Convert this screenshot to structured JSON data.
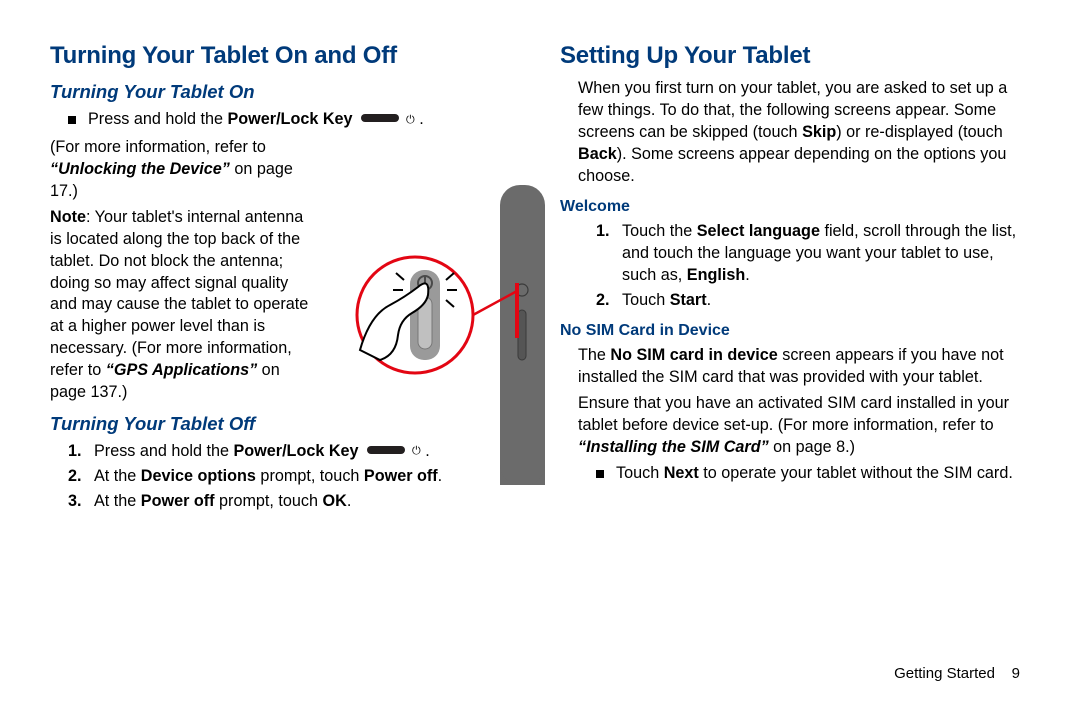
{
  "left": {
    "h1": "Turning Your Tablet On and Off",
    "on_h2": "Turning Your Tablet On",
    "on_bullet_pre": "Press and hold the ",
    "on_bullet_bold": "Power/Lock Key",
    "on_bullet_post": " .",
    "para1_pre": "(For more information, refer to ",
    "para1_ital": "“Unlocking the Device”",
    "para1_mid": " on page 17.)",
    "note_label": "Note",
    "note_body_pre": ": Your tablet's internal antenna is located along the top back of the tablet. Do not block the antenna; doing so may affect signal quality and may cause the tablet to operate at a higher power level than is necessary. (For more information, refer to ",
    "note_ital": "“GPS Applications”",
    "note_post": " on page 137.)",
    "off_h2": "Turning Your Tablet Off",
    "off1_pre": "Press and hold the ",
    "off1_bold": "Power/Lock Key",
    "off1_post": " .",
    "off2_pre": "At the ",
    "off2_bold1": "Device options",
    "off2_mid": " prompt, touch ",
    "off2_bold2": "Power off",
    "off2_post": ".",
    "off3_pre": "At the ",
    "off3_bold1": "Power off",
    "off3_mid": " prompt, touch ",
    "off3_bold2": "OK",
    "off3_post": "."
  },
  "right": {
    "h1": "Setting Up Your Tablet",
    "intro_pre": "When you first turn on your tablet, you are asked to set up a few things. To do that, the following screens appear. Some screens can be skipped (touch ",
    "intro_b1": "Skip",
    "intro_mid": ") or re-displayed (touch ",
    "intro_b2": "Back",
    "intro_post": "). Some screens appear depending on the options you choose.",
    "welcome_h3": "Welcome",
    "w1_pre": "Touch the ",
    "w1_bold": "Select language",
    "w1_mid": " field, scroll through the list, and touch the language you want your tablet to use, such as, ",
    "w1_bold2": "English",
    "w1_post": ".",
    "w2_pre": "Touch ",
    "w2_bold": "Start",
    "w2_post": ".",
    "nosim_h3": "No SIM Card in Device",
    "ns_p1_pre": "The ",
    "ns_p1_bold": "No SIM card in device",
    "ns_p1_post": " screen appears if you have not installed the SIM card that was provided with your tablet.",
    "ns_p2_pre": "Ensure that you have an activated SIM card installed in your tablet before device set-up. (For more information, refer to ",
    "ns_p2_ital": "“Installing the SIM Card”",
    "ns_p2_post": " on page 8.)",
    "ns_bul_pre": "Touch ",
    "ns_bul_bold": "Next",
    "ns_bul_post": " to operate your tablet without the SIM card."
  },
  "footer": {
    "section": "Getting Started",
    "page": "9"
  }
}
